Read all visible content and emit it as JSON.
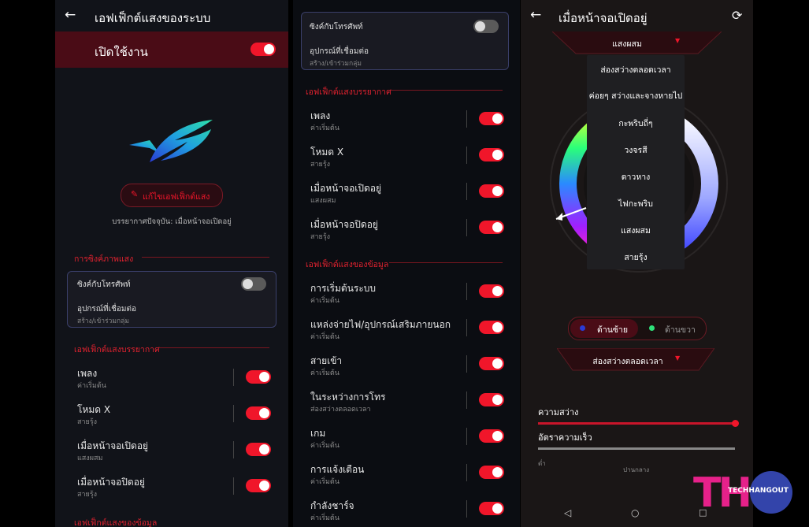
{
  "panel1": {
    "title": "เอฟเฟ็กต์แสงของระบบ",
    "enable_label": "เปิดใช้งาน",
    "edit_button": "แก้ไขเอฟเฟ็กต์แสง",
    "current_scene": "บรรยากาศปัจจุบัน: เมื่อหน้าจอเปิดอยู่",
    "sync_section": "การซิงค์ภาพแสง",
    "sync_card": {
      "title": "ซิงค์กับโทรศัพท์",
      "devices": "อุปกรณ์ที่เชื่อมต่อ",
      "devices_sub": "สร้าง/เข้าร่วมกลุ่ม"
    },
    "ambient_section": "เอฟเฟ็กต์แสงบรรยากาศ",
    "items": [
      {
        "title": "เพลง",
        "sub": "ค่าเริ่มต้น"
      },
      {
        "title": "โหมด X",
        "sub": "สายรุ้ง"
      },
      {
        "title": "เมื่อหน้าจอเปิดอยู่",
        "sub": "แสงผสม"
      },
      {
        "title": "เมื่อหน้าจอปิดอยู่",
        "sub": "สายรุ้ง"
      }
    ],
    "info_section": "เอฟเฟ็กต์แสงของข้อมูล"
  },
  "panel2": {
    "sync_card": {
      "title": "ซิงค์กับโทรศัพท์",
      "devices": "อุปกรณ์ที่เชื่อมต่อ",
      "devices_sub": "สร้าง/เข้าร่วมกลุ่ม"
    },
    "ambient_section": "เอฟเฟ็กต์แสงบรรยากาศ",
    "ambient_items": [
      {
        "title": "เพลง",
        "sub": "ค่าเริ่มต้น"
      },
      {
        "title": "โหมด X",
        "sub": "สายรุ้ง"
      },
      {
        "title": "เมื่อหน้าจอเปิดอยู่",
        "sub": "แสงผสม"
      },
      {
        "title": "เมื่อหน้าจอปิดอยู่",
        "sub": "สายรุ้ง"
      }
    ],
    "info_section": "เอฟเฟ็กต์แสงของข้อมูล",
    "info_items": [
      {
        "title": "การเริ่มต้นระบบ",
        "sub": "ค่าเริ่มต้น"
      },
      {
        "title": "แหล่งจ่ายไฟ/อุปกรณ์เสริมภายนอก",
        "sub": "ค่าเริ่มต้น"
      },
      {
        "title": "สายเข้า",
        "sub": "ค่าเริ่มต้น"
      },
      {
        "title": "ในระหว่างการโทร",
        "sub": "ส่องสว่างตลอดเวลา"
      },
      {
        "title": "เกม",
        "sub": "ค่าเริ่มต้น"
      },
      {
        "title": "การแจ้งเตือน",
        "sub": "ค่าเริ่มต้น"
      },
      {
        "title": "กำลังชาร์จ",
        "sub": "ค่าเริ่มต้น"
      }
    ]
  },
  "panel3": {
    "title": "เมื่อหน้าจอเปิดอยู่",
    "effect_selected": "แสงผสม",
    "dropdown_options": [
      "ส่องสว่างตลอดเวลา",
      "ค่อยๆ สว่างและจางหายไป",
      "กะพริบถี่ๆ",
      "วงจรสี",
      "ดาวหาง",
      "ไฟกะพริบ",
      "แสงผสม",
      "สายรุ้ง"
    ],
    "left_label": "ด้านซ้าย",
    "right_label": "ด้านขวา",
    "mode_selected": "ส่องสว่างตลอดเวลา",
    "brightness_label": "ความสว่าง",
    "brightness_value": 1.0,
    "speed_label": "อัตราความเร็ว",
    "speed_value": 1.0,
    "speed_low": "ต่ำ",
    "speed_mid": "ปานกลาง"
  },
  "watermark": {
    "text": "TECHHANGOUT",
    "letters": "TH"
  },
  "colors": {
    "accent": "#f0162a",
    "bg": "#111319",
    "dropdown": "#1f1f22"
  }
}
